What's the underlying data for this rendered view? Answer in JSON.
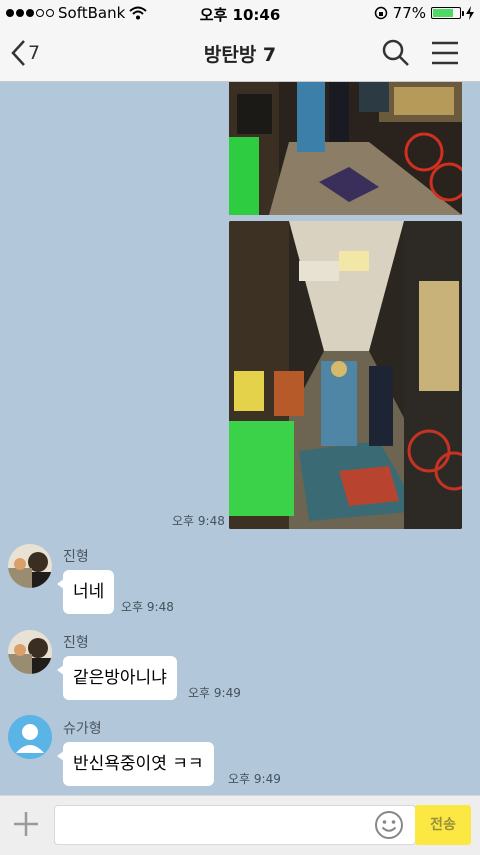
{
  "status_bar": {
    "carrier": "SoftBank",
    "time": "오후 10:46",
    "battery_percent": "77%",
    "battery_level": 0.77,
    "signal_bars_filled": 3,
    "signal_bars_total": 5
  },
  "header": {
    "back_count": "7",
    "title": "방탄방 7"
  },
  "messages": [
    {
      "type": "image",
      "sender": "self",
      "time": ""
    },
    {
      "type": "image",
      "sender": "self",
      "time": "오후 9:48"
    },
    {
      "type": "text",
      "sender": "진형",
      "text": "너네",
      "time": "오후 9:48"
    },
    {
      "type": "text",
      "sender": "진형",
      "text": "같은방아니냐",
      "time": "오후 9:49"
    },
    {
      "type": "text",
      "sender": "슈가형",
      "text": "반신욕중이엿 ㅋㅋ",
      "time": "오후 9:49"
    }
  ],
  "input": {
    "placeholder": "",
    "send_label": "전송"
  },
  "icons": {
    "back": "chevron-left-icon",
    "search": "search-icon",
    "menu": "menu-icon",
    "plus": "plus-icon",
    "emoji": "emoji-icon"
  },
  "colors": {
    "chat_background": "#b2c7d9",
    "send_button": "#fce843",
    "default_avatar": "#5ab4e6"
  }
}
